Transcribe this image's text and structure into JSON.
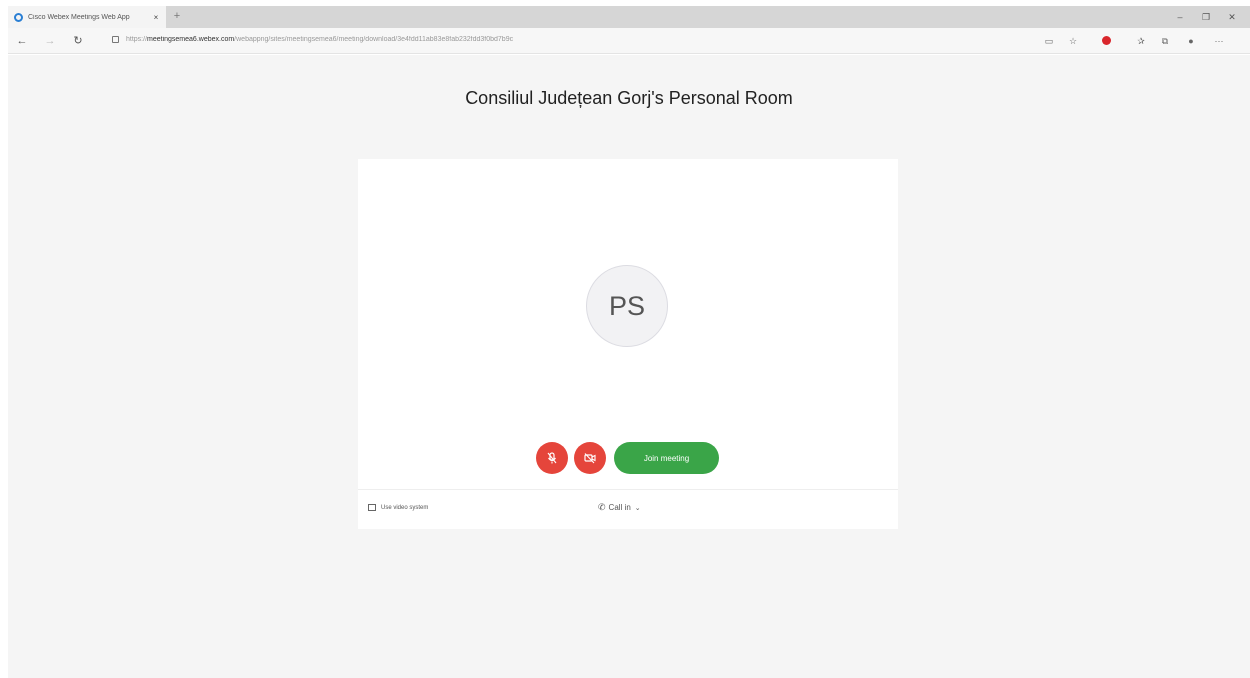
{
  "browser": {
    "tab_title": "Cisco Webex Meetings Web App",
    "tab_close": "×",
    "new_tab": "+",
    "url_scheme": "https://",
    "url_host": "meetingsemea6.webex.com",
    "url_path": "/webappng/sites/meetingsemea6/meeting/download/3e4fdd11ab83e8fab232fdd3f0bd7b9c",
    "window_minimize": "–",
    "window_restore": "❐",
    "window_close": "✕",
    "nav_back": "←",
    "nav_forward": "→",
    "nav_refresh": "↻",
    "toolbar_icons": {
      "reading_view": "▭",
      "favorite": "☆",
      "favorites_bar": "✰",
      "collections": "⧉",
      "profile": "●",
      "more": "···"
    },
    "colors": {
      "extension_red": "#d9262c",
      "favicon_blue": "#2a7fd4"
    }
  },
  "page": {
    "room_title": "Consiliul Județean Gorj's Personal Room",
    "avatar_initials": "PS",
    "join_button_label": "Join meeting",
    "video_system_label": "Use video system",
    "call_in_label": "Call in",
    "icons": {
      "mic": "microphone-off-icon",
      "video": "video-off-icon",
      "phone": "phone-icon",
      "chevron": "chevron-down-icon"
    },
    "colors": {
      "mute_red": "#e5453b",
      "join_green": "#3aa548",
      "page_bg": "#f5f5f5"
    }
  }
}
